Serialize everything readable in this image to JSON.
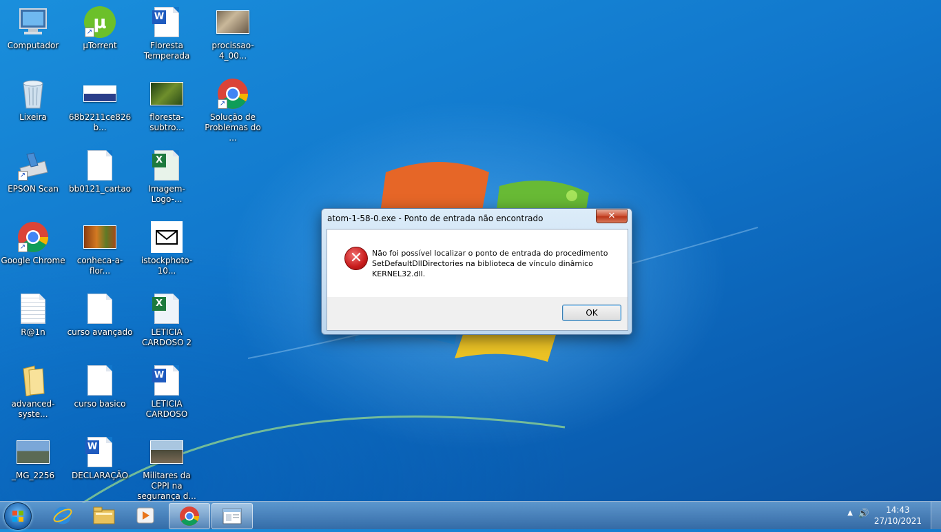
{
  "desktop": {
    "icons": [
      {
        "label": "Computador",
        "icon": "computer-icon"
      },
      {
        "label": "µTorrent",
        "icon": "utorrent-icon"
      },
      {
        "label": "Floresta Temperada",
        "icon": "word-document-icon"
      },
      {
        "label": "procissao-4_00...",
        "icon": "image-file-icon"
      },
      {
        "label": "Lixeira",
        "icon": "recycle-bin-icon"
      },
      {
        "label": "68b2211ce826b...",
        "icon": "image-file-icon"
      },
      {
        "label": "floresta-subtro...",
        "icon": "image-file-icon"
      },
      {
        "label": "Solução de Problemas do ...",
        "icon": "chrome-icon"
      },
      {
        "label": "EPSON Scan",
        "icon": "scanner-icon"
      },
      {
        "label": "bb0121_cartao",
        "icon": "blank-file-icon"
      },
      {
        "label": "Imagem-Logo-...",
        "icon": "excel-file-icon"
      },
      {
        "label": "Google Chrome",
        "icon": "chrome-icon"
      },
      {
        "label": "conheca-a-flor...",
        "icon": "image-file-icon"
      },
      {
        "label": "istockphoto-10...",
        "icon": "envelope-icon"
      },
      {
        "label": "R@1n",
        "icon": "text-file-icon"
      },
      {
        "label": "curso avançado",
        "icon": "blank-file-icon"
      },
      {
        "label": "LETICIA CARDOSO 2",
        "icon": "excel-file-icon"
      },
      {
        "label": "advanced-syste...",
        "icon": "folder-icon"
      },
      {
        "label": "curso basico",
        "icon": "blank-file-icon"
      },
      {
        "label": "LETICIA CARDOSO",
        "icon": "word-document-icon"
      },
      {
        "label": "_MG_2256",
        "icon": "image-file-icon"
      },
      {
        "label": "DECLARAÇÃO",
        "icon": "word-document-icon"
      },
      {
        "label": "Militares da CPPI na segurança d...",
        "icon": "image-file-icon"
      }
    ]
  },
  "dialog": {
    "title": "atom-1-58-0.exe - Ponto de entrada não encontrado",
    "close_label": "✕",
    "icon": "error-icon",
    "message": "Não foi possível localizar o ponto de entrada do procedimento SetDefaultDllDirectories na biblioteca de vínculo dinâmico KERNEL32.dll.",
    "ok_label": "OK"
  },
  "taskbar": {
    "pinned": [
      {
        "name": "internet-explorer",
        "icon": "ie-icon"
      },
      {
        "name": "file-explorer",
        "icon": "folder-icon"
      },
      {
        "name": "media-player",
        "icon": "media-player-icon"
      },
      {
        "name": "google-chrome",
        "icon": "chrome-icon"
      },
      {
        "name": "error-dialog-window",
        "icon": "window-icon"
      }
    ],
    "clock": {
      "time": "14:43",
      "date": "27/10/2021"
    },
    "colors": {
      "accent": "#1177cc",
      "error": "#c81c1c"
    }
  }
}
